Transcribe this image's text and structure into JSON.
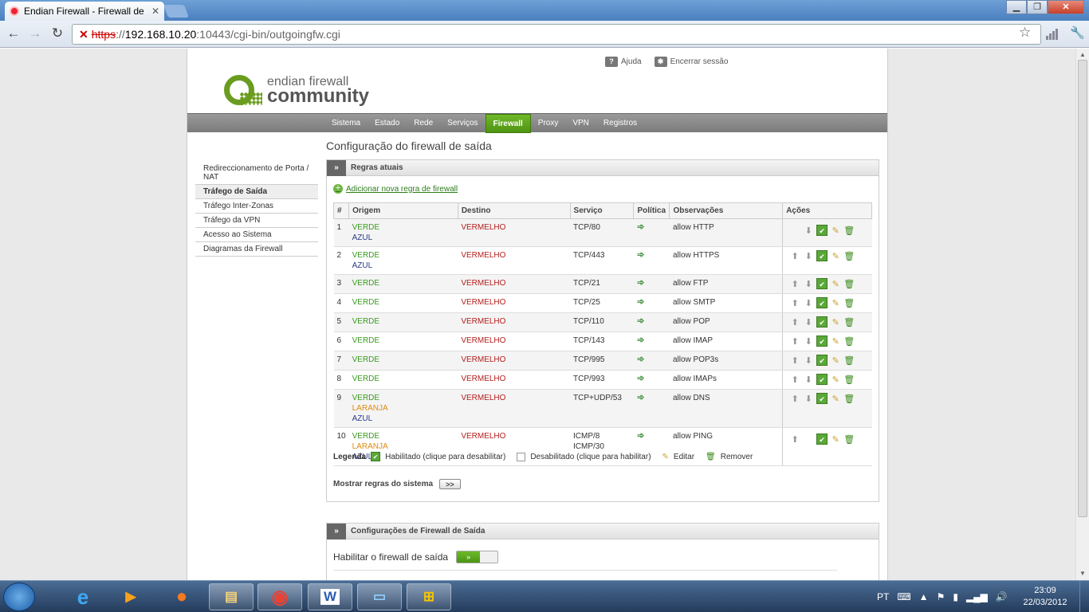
{
  "browser": {
    "tab_title": "Endian Firewall - Firewall de",
    "url_scheme": "https",
    "url_host": "192.168.10.20",
    "url_rest": ":10443/cgi-bin/outgoingfw.cgi"
  },
  "header": {
    "help": "Ajuda",
    "logout": "Encerrar sessão",
    "logo_line1": "endian firewall",
    "logo_line2": "community"
  },
  "mainnav": [
    "Sistema",
    "Estado",
    "Rede",
    "Serviços",
    "Firewall",
    "Proxy",
    "VPN",
    "Registros"
  ],
  "mainnav_active": "Firewall",
  "sidenav": [
    "Redireccionamento de Porta / NAT",
    "Tráfego de Saída",
    "Tráfego Inter-Zonas",
    "Tráfego da VPN",
    "Acesso ao Sistema",
    "Diagramas da Firewall"
  ],
  "sidenav_active": "Tráfego de Saída",
  "page_title": "Configuração do firewall de saída",
  "rules_panel": {
    "title": "Regras atuais",
    "add_rule": "Adicionar nova regra de firewall",
    "columns": [
      "#",
      "Origem",
      "Destino",
      "Serviço",
      "Política",
      "Observações",
      "Ações"
    ],
    "rows": [
      {
        "n": "1",
        "origem": [
          "VERDE",
          "AZUL"
        ],
        "destino": "VERMELHO",
        "servico": [
          "TCP/80"
        ],
        "obs": "allow HTTP",
        "up": false,
        "down": true
      },
      {
        "n": "2",
        "origem": [
          "VERDE",
          "AZUL"
        ],
        "destino": "VERMELHO",
        "servico": [
          "TCP/443"
        ],
        "obs": "allow HTTPS",
        "up": true,
        "down": true
      },
      {
        "n": "3",
        "origem": [
          "VERDE"
        ],
        "destino": "VERMELHO",
        "servico": [
          "TCP/21"
        ],
        "obs": "allow FTP",
        "up": true,
        "down": true
      },
      {
        "n": "4",
        "origem": [
          "VERDE"
        ],
        "destino": "VERMELHO",
        "servico": [
          "TCP/25"
        ],
        "obs": "allow SMTP",
        "up": true,
        "down": true
      },
      {
        "n": "5",
        "origem": [
          "VERDE"
        ],
        "destino": "VERMELHO",
        "servico": [
          "TCP/110"
        ],
        "obs": "allow POP",
        "up": true,
        "down": true
      },
      {
        "n": "6",
        "origem": [
          "VERDE"
        ],
        "destino": "VERMELHO",
        "servico": [
          "TCP/143"
        ],
        "obs": "allow IMAP",
        "up": true,
        "down": true
      },
      {
        "n": "7",
        "origem": [
          "VERDE"
        ],
        "destino": "VERMELHO",
        "servico": [
          "TCP/995"
        ],
        "obs": "allow POP3s",
        "up": true,
        "down": true
      },
      {
        "n": "8",
        "origem": [
          "VERDE"
        ],
        "destino": "VERMELHO",
        "servico": [
          "TCP/993"
        ],
        "obs": "allow IMAPs",
        "up": true,
        "down": true
      },
      {
        "n": "9",
        "origem": [
          "VERDE",
          "LARANJA",
          "AZUL"
        ],
        "destino": "VERMELHO",
        "servico": [
          "TCP+UDP/53"
        ],
        "obs": "allow DNS",
        "up": true,
        "down": true
      },
      {
        "n": "10",
        "origem": [
          "VERDE",
          "LARANJA",
          "AZUL"
        ],
        "destino": "VERMELHO",
        "servico": [
          "ICMP/8",
          "ICMP/30"
        ],
        "obs": "allow PING",
        "up": true,
        "down": false
      }
    ],
    "legend": {
      "label": "Legenda",
      "enabled": "Habilitado (clique para desabilitar)",
      "disabled": "Desabilitado (clique para habilitar)",
      "edit": "Editar",
      "remove": "Remover"
    },
    "show_system_rules": "Mostrar regras do sistema",
    "show_button": ">>"
  },
  "settings_panel": {
    "title": "Configurações de Firewall de Saída",
    "enable_label": "Habilitar o firewall de saída",
    "toggle_on": "»"
  },
  "taskbar": {
    "lang": "PT",
    "time": "23:09",
    "date": "22/03/2012"
  },
  "colors": {
    "green_zone": "#3a9b1f",
    "red_zone": "#b31d1d",
    "orange_zone": "#e08a10",
    "blue_zone": "#2a3a88",
    "nav_active": "#5ea51c"
  }
}
